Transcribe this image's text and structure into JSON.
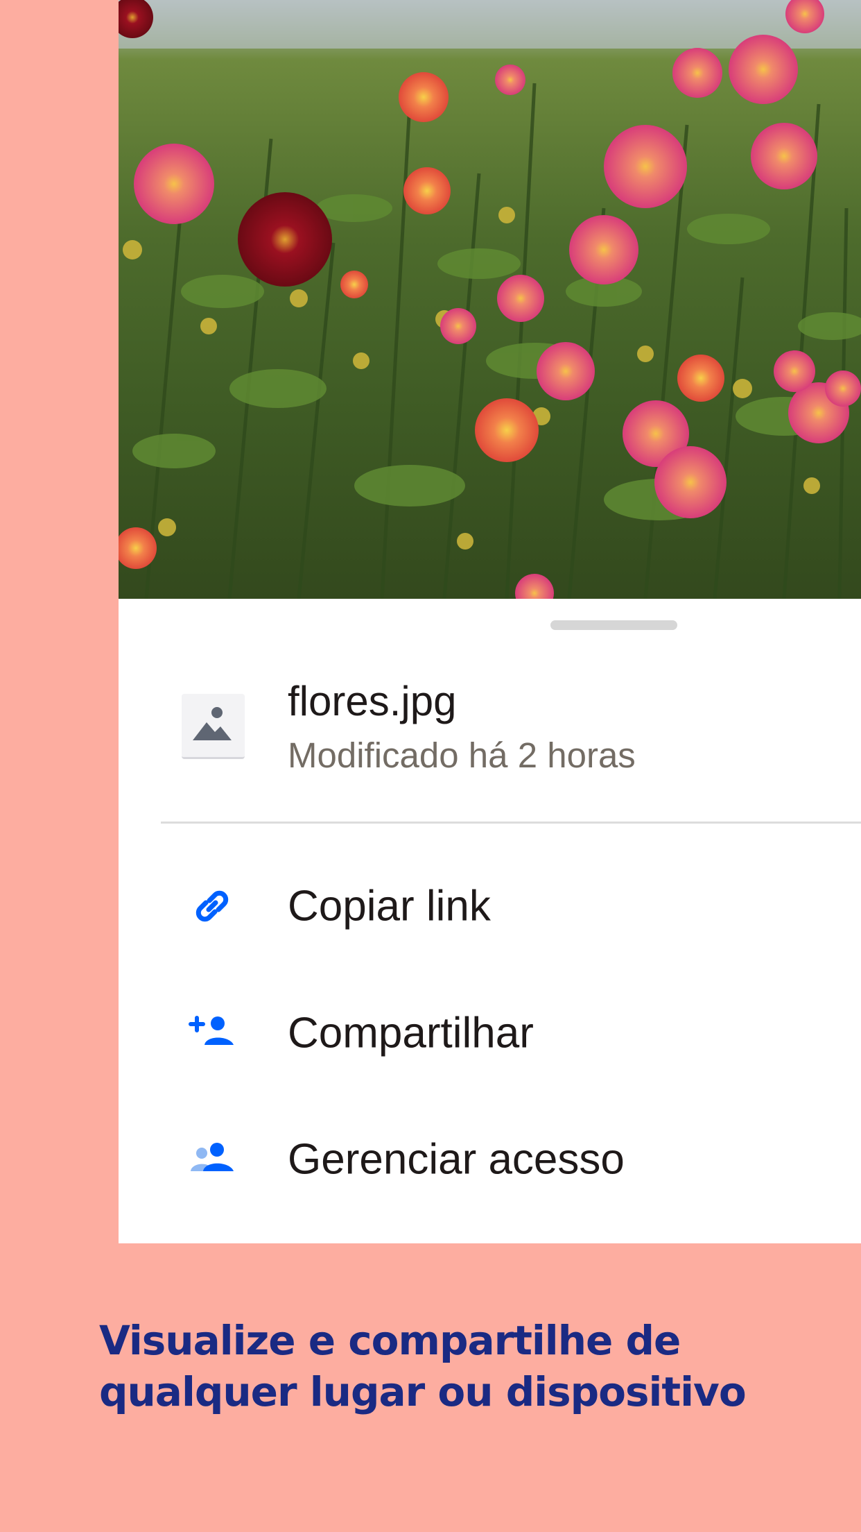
{
  "photo": {
    "subject_icon": "flower-photo"
  },
  "sheet": {
    "file": {
      "name": "flores.jpg",
      "meta": "Modificado há 2 horas",
      "thumb_icon": "image-icon"
    },
    "actions": [
      {
        "label": "Copiar link",
        "icon": "link-icon"
      },
      {
        "label": "Compartilhar",
        "icon": "add-person-icon"
      },
      {
        "label": "Gerenciar acesso",
        "icon": "people-icon"
      }
    ]
  },
  "tagline": "Visualize e compartilhe de qualquer lugar ou dispositivo",
  "colors": {
    "background": "#FDADA0",
    "accent_blue": "#0061FE",
    "tagline": "#1A2A83"
  }
}
